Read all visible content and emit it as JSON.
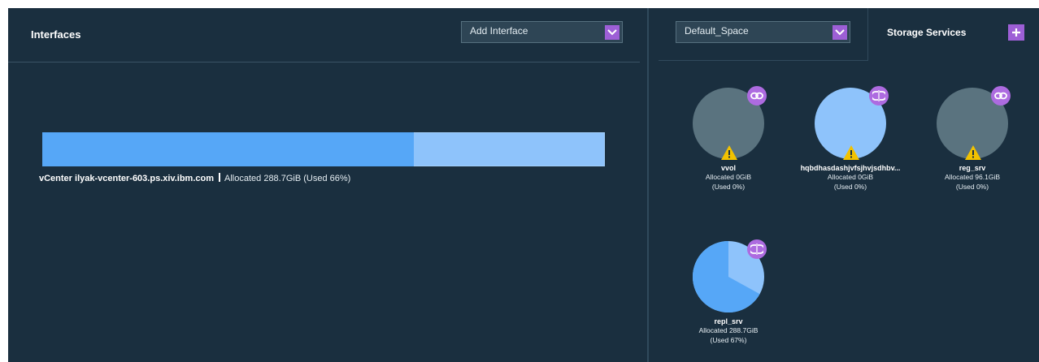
{
  "interfaces": {
    "title": "Interfaces",
    "add_dropdown": {
      "selected": "Add Interface"
    },
    "items": [
      {
        "name": "vCenter ilyak-vcenter-603.ps.xiv.ibm.com",
        "allocated": "Allocated 288.7GiB (Used 66%)",
        "used_fraction": 0.66
      }
    ]
  },
  "storage": {
    "space_dropdown": {
      "selected": "Default_Space"
    },
    "tab_label": "Storage Services",
    "pools": [
      {
        "name": "vvol",
        "allocated": "Allocated 0GiB",
        "used": "(Used 0%)",
        "used_fraction": 0,
        "badge_icon": "link-icon",
        "warning": true,
        "fill": "#5a737f"
      },
      {
        "name": "hqbdhasdashjvfsjhvjsdhbv...",
        "allocated": "Allocated 0GiB",
        "used": "(Used 0%)",
        "used_fraction": 0,
        "badge_icon": "replication-icon",
        "warning": true,
        "fill": "#8ec3fb"
      },
      {
        "name": "reg_srv",
        "allocated": "Allocated 96.1GiB",
        "used": "(Used 0%)",
        "used_fraction": 0,
        "badge_icon": "link-icon",
        "warning": true,
        "fill": "#5a737f"
      },
      {
        "name": "repl_srv",
        "allocated": "Allocated 288.7GiB",
        "used": "(Used 67%)",
        "used_fraction": 0.67,
        "badge_icon": "replication-icon",
        "warning": false,
        "fill": "#8ec3fb",
        "used_color": "#56a7f7"
      }
    ]
  },
  "colors": {
    "panel_bg": "#1a2f3f",
    "accent_purple": "#9d5fd6",
    "bar_used": "#56a7f7",
    "bar_free": "#8ec3fb",
    "warning": "#f2c200"
  }
}
